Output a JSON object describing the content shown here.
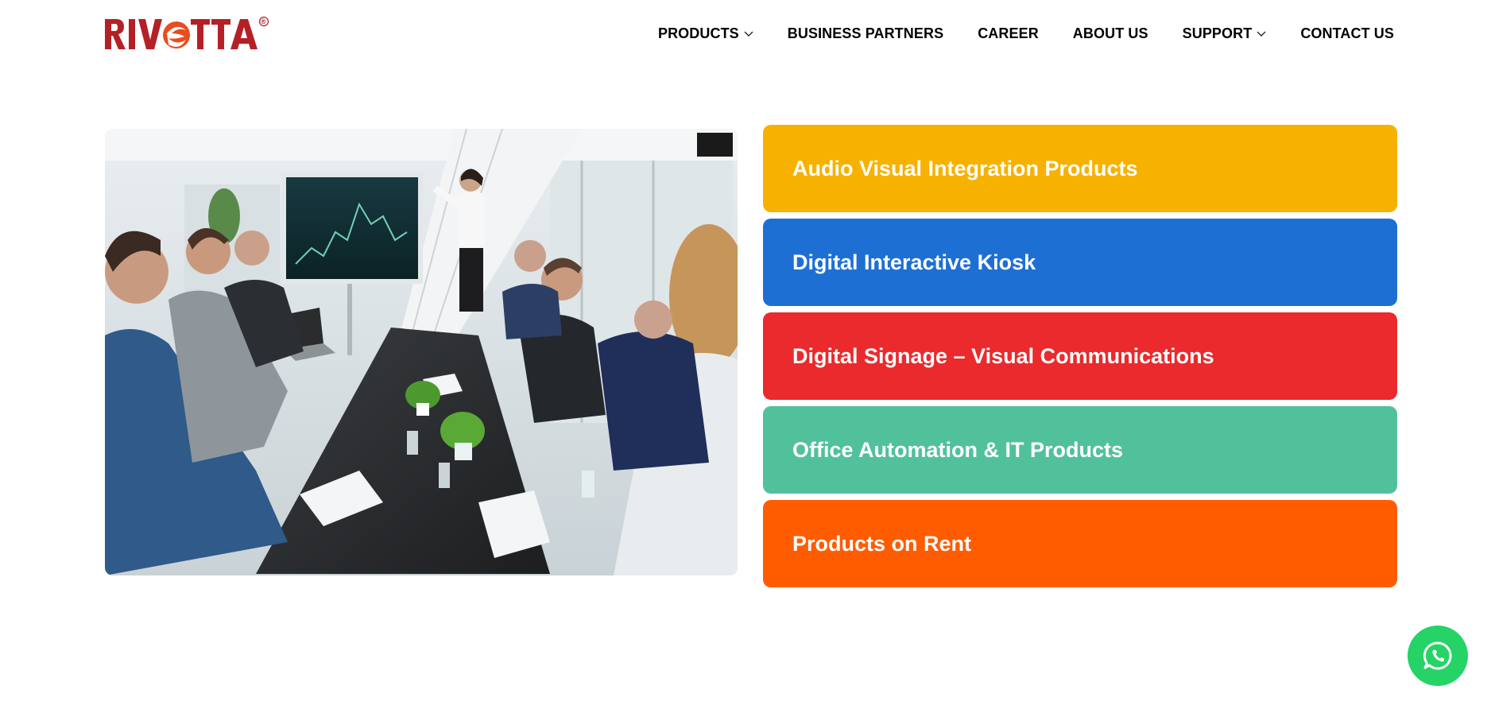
{
  "brand": {
    "logo_text": "RIVETTA",
    "registered_mark": "®"
  },
  "nav": {
    "items": [
      {
        "label": "PRODUCTS",
        "has_dropdown": true
      },
      {
        "label": "BUSINESS PARTNERS",
        "has_dropdown": false
      },
      {
        "label": "CAREER",
        "has_dropdown": false
      },
      {
        "label": "ABOUT US",
        "has_dropdown": false
      },
      {
        "label": "SUPPORT",
        "has_dropdown": true
      },
      {
        "label": "CONTACT US",
        "has_dropdown": false
      }
    ]
  },
  "hero": {
    "image_subject": "meeting-room-presentation-photo"
  },
  "categories": [
    {
      "label": "Audio Visual Integration Products",
      "color": "#f7b100"
    },
    {
      "label": "Digital Interactive Kiosk",
      "color": "#1e6fd3"
    },
    {
      "label": "Digital Signage – Visual Communications",
      "color": "#ea2a2c"
    },
    {
      "label": "Office Automation & IT Products",
      "color": "#51c19c"
    },
    {
      "label": "Products on Rent",
      "color": "#ff5c00"
    }
  ],
  "floating": {
    "whatsapp_icon": "whatsapp-icon",
    "whatsapp_color": "#25d366"
  },
  "colors": {
    "logo_red": "#b52027",
    "logo_orange": "#ea4b1f"
  }
}
